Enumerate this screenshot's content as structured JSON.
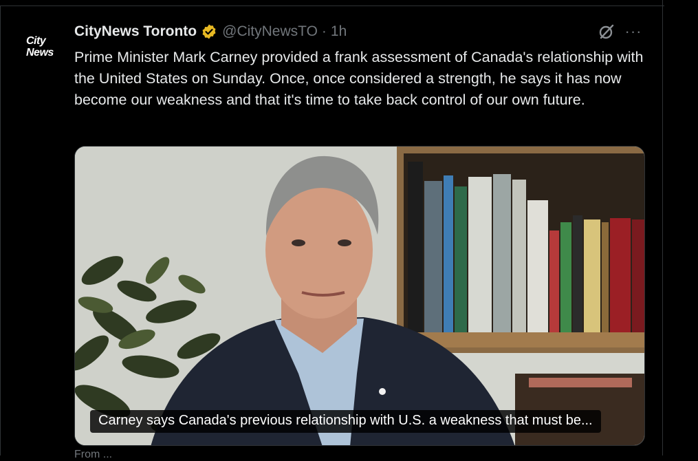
{
  "post": {
    "avatar": {
      "line1": "City",
      "line2": "News"
    },
    "display_name": "CityNews Toronto",
    "handle": "@CityNewsTO",
    "separator": "·",
    "time": "1h",
    "more": "···",
    "text": "Prime Minister Mark Carney provided a frank assessment of Canada's relationship with the United States on Sunday. Once, once considered a strength, he says it has now become our weakness and that it's time to take back control of our own future.",
    "media": {
      "caption": "Carney says Canada's previous relationship with U.S. a weakness that must be..."
    },
    "below": "From ..."
  },
  "colors": {
    "background": "#000000",
    "text": "#e7e9ea",
    "muted": "#71767b",
    "verified_gold": "#e8b923",
    "divider": "#2f3336"
  },
  "icons": [
    "verified-badge-icon",
    "grok-icon",
    "more-icon"
  ]
}
